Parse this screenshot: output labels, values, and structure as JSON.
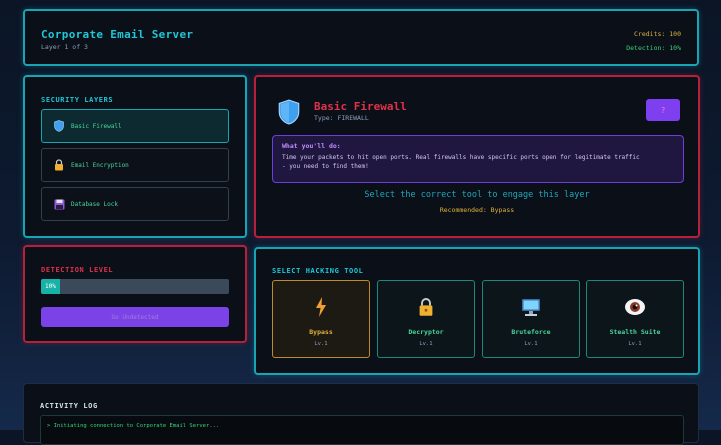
{
  "header": {
    "title": "Corporate Email Server",
    "subtitle": "Layer 1 of 3",
    "credits": "Credits: 100",
    "detection": "Detection: 10%"
  },
  "layers_panel": {
    "title": "SECURITY LAYERS",
    "items": [
      {
        "label": "Basic Firewall",
        "icon": "shield-icon",
        "active": true
      },
      {
        "label": "Email Encryption",
        "icon": "lock-icon",
        "active": false
      },
      {
        "label": "Database Lock",
        "icon": "disk-icon",
        "active": false
      }
    ]
  },
  "layer_detail": {
    "name": "Basic Firewall",
    "type": "Type: FIREWALL",
    "info_title": "What you'll do:",
    "info_text": "Time your packets to hit open ports. Real firewalls have specific ports open for legitimate traffic - you need to find them!",
    "engage_text": "Select the correct tool to engage this layer",
    "recommended": "Recommended: Bypass"
  },
  "detection_panel": {
    "title": "DETECTION LEVEL",
    "level": 0.1,
    "bar_label": "10%",
    "button_label": "Go Undetected"
  },
  "tools_panel": {
    "title": "SELECT HACKING TOOL",
    "tools": [
      {
        "name": "Bypass",
        "level": "Lv.1",
        "icon": "lightning-icon",
        "active": true
      },
      {
        "name": "Decryptor",
        "level": "Lv.1",
        "icon": "lock-icon",
        "active": false
      },
      {
        "name": "Bruteforce",
        "level": "Lv.1",
        "icon": "computer-icon",
        "active": false
      },
      {
        "name": "Stealth Suite",
        "level": "Lv.1",
        "icon": "eye-icon",
        "active": false
      }
    ]
  },
  "activity_log": {
    "title": "ACTIVITY LOG",
    "lines": [
      "> Initiating connection to Corporate Email Server..."
    ]
  },
  "colors": {
    "accent_cyan": "#1aa3b3",
    "alert_red": "#b3223a",
    "purple": "#7d3ff0",
    "gold": "#e0b23b",
    "green": "#4ad69a"
  }
}
